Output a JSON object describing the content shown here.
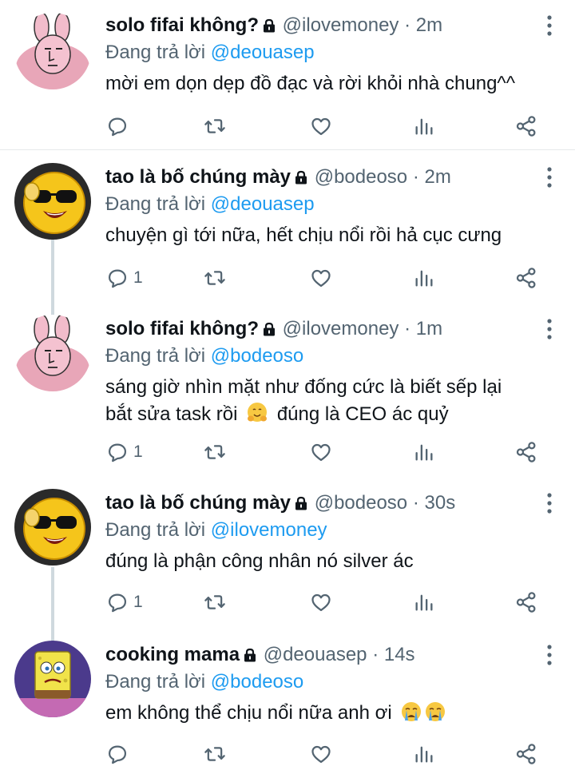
{
  "colors": {
    "accent": "#1d9bf0",
    "secondary_text": "#536471",
    "primary_text": "#0f1419"
  },
  "tweets": [
    {
      "name": "solo fifai không?",
      "handle": "@ilovemoney",
      "separator": "·",
      "time": "2m",
      "replying_prefix": "Đang trả lời",
      "replying_to": "@deouasep",
      "text": "mời em dọn dẹp đồ đạc và rời khỏi nhà chung^^",
      "reply_count": "",
      "avatar": "pink-bunny-avatar"
    },
    {
      "name": "tao là bố chúng mày",
      "handle": "@bodeoso",
      "separator": "·",
      "time": "2m",
      "replying_prefix": "Đang trả lời",
      "replying_to": "@deouasep",
      "text": "chuyện gì tới nữa, hết chịu nổi rồi hả cục cưng",
      "reply_count": "1",
      "avatar": "cool-smiley-avatar"
    },
    {
      "name": "solo fifai không?",
      "handle": "@ilovemoney",
      "separator": "·",
      "time": "1m",
      "replying_prefix": "Đang trả lời",
      "replying_to": "@bodeoso",
      "text_line1": "sáng giờ nhìn mặt như đống cức là biết sếp lại",
      "text_line2_before": "bắt sửa task rồi",
      "text_emoji": "hugging-face-emoji",
      "text_line2_after": "đúng là CEO ác quỷ",
      "reply_count": "1",
      "avatar": "pink-bunny-avatar"
    },
    {
      "name": "tao là bố chúng mày",
      "handle": "@bodeoso",
      "separator": "·",
      "time": "30s",
      "replying_prefix": "Đang trả lời",
      "replying_to": "@ilovemoney",
      "text": "đúng là phận công nhân nó silver ác",
      "reply_count": "1",
      "avatar": "cool-smiley-avatar"
    },
    {
      "name": "cooking mama",
      "handle": "@deouasep",
      "separator": "·",
      "time": "14s",
      "replying_prefix": "Đang trả lời",
      "replying_to": "@bodeoso",
      "text": "em không thể chịu nổi nữa anh ơi",
      "text_emoji": "loudly-crying-face-emoji",
      "reply_count": "",
      "avatar": "spongebob-avatar"
    }
  ]
}
